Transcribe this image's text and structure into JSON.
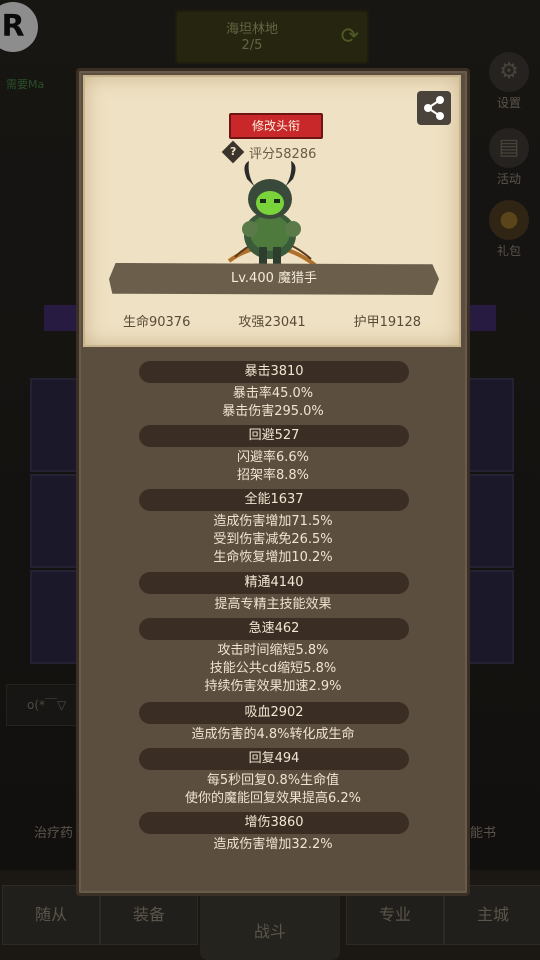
{
  "background": {
    "logo": "R",
    "zone_title": "海坦林地",
    "zone_progress": "2/5",
    "green_text": "需要Ma",
    "side_buttons": [
      {
        "label": "设置",
        "icon": "gear-icon"
      },
      {
        "label": "活动",
        "icon": "scroll-icon"
      },
      {
        "label": "礼包",
        "icon": "giftbag-icon"
      }
    ],
    "input_placeholder": "o(*￣▽",
    "left_label": "治疗药",
    "right_label": "能书",
    "tabs": [
      "随从",
      "装备",
      "战斗",
      "专业",
      "主城"
    ]
  },
  "dialog": {
    "rename_button": "修改头衔",
    "score": "评分58286",
    "hero_name": "Lv.400 魔猎手",
    "base_stats": [
      "生命90376",
      "攻强23041",
      "护甲19128"
    ],
    "stat_groups": [
      {
        "header": "暴击3810",
        "lines": [
          "暴击率45.0%",
          "暴击伤害295.0%"
        ]
      },
      {
        "header": "回避527",
        "lines": [
          "闪避率6.6%",
          "招架率8.8%"
        ]
      },
      {
        "header": "全能1637",
        "lines": [
          "造成伤害增加71.5%",
          "受到伤害减免26.5%",
          "生命恢复增加10.2%"
        ]
      },
      {
        "header": "精通4140",
        "lines": [
          "提高专精主技能效果"
        ]
      },
      {
        "header": "急速462",
        "lines": [
          "攻击时间缩短5.8%",
          "技能公共cd缩短5.8%",
          "持续伤害效果加速2.9%"
        ]
      },
      {
        "header": "吸血2902",
        "lines": [
          "造成伤害的4.8%转化成生命"
        ]
      },
      {
        "header": "回复494",
        "lines": [
          "每5秒回复0.8%生命值",
          "使你的魔能回复效果提高6.2%"
        ]
      },
      {
        "header": "增伤3860",
        "lines": [
          "造成伤害增加32.2%"
        ]
      }
    ]
  }
}
